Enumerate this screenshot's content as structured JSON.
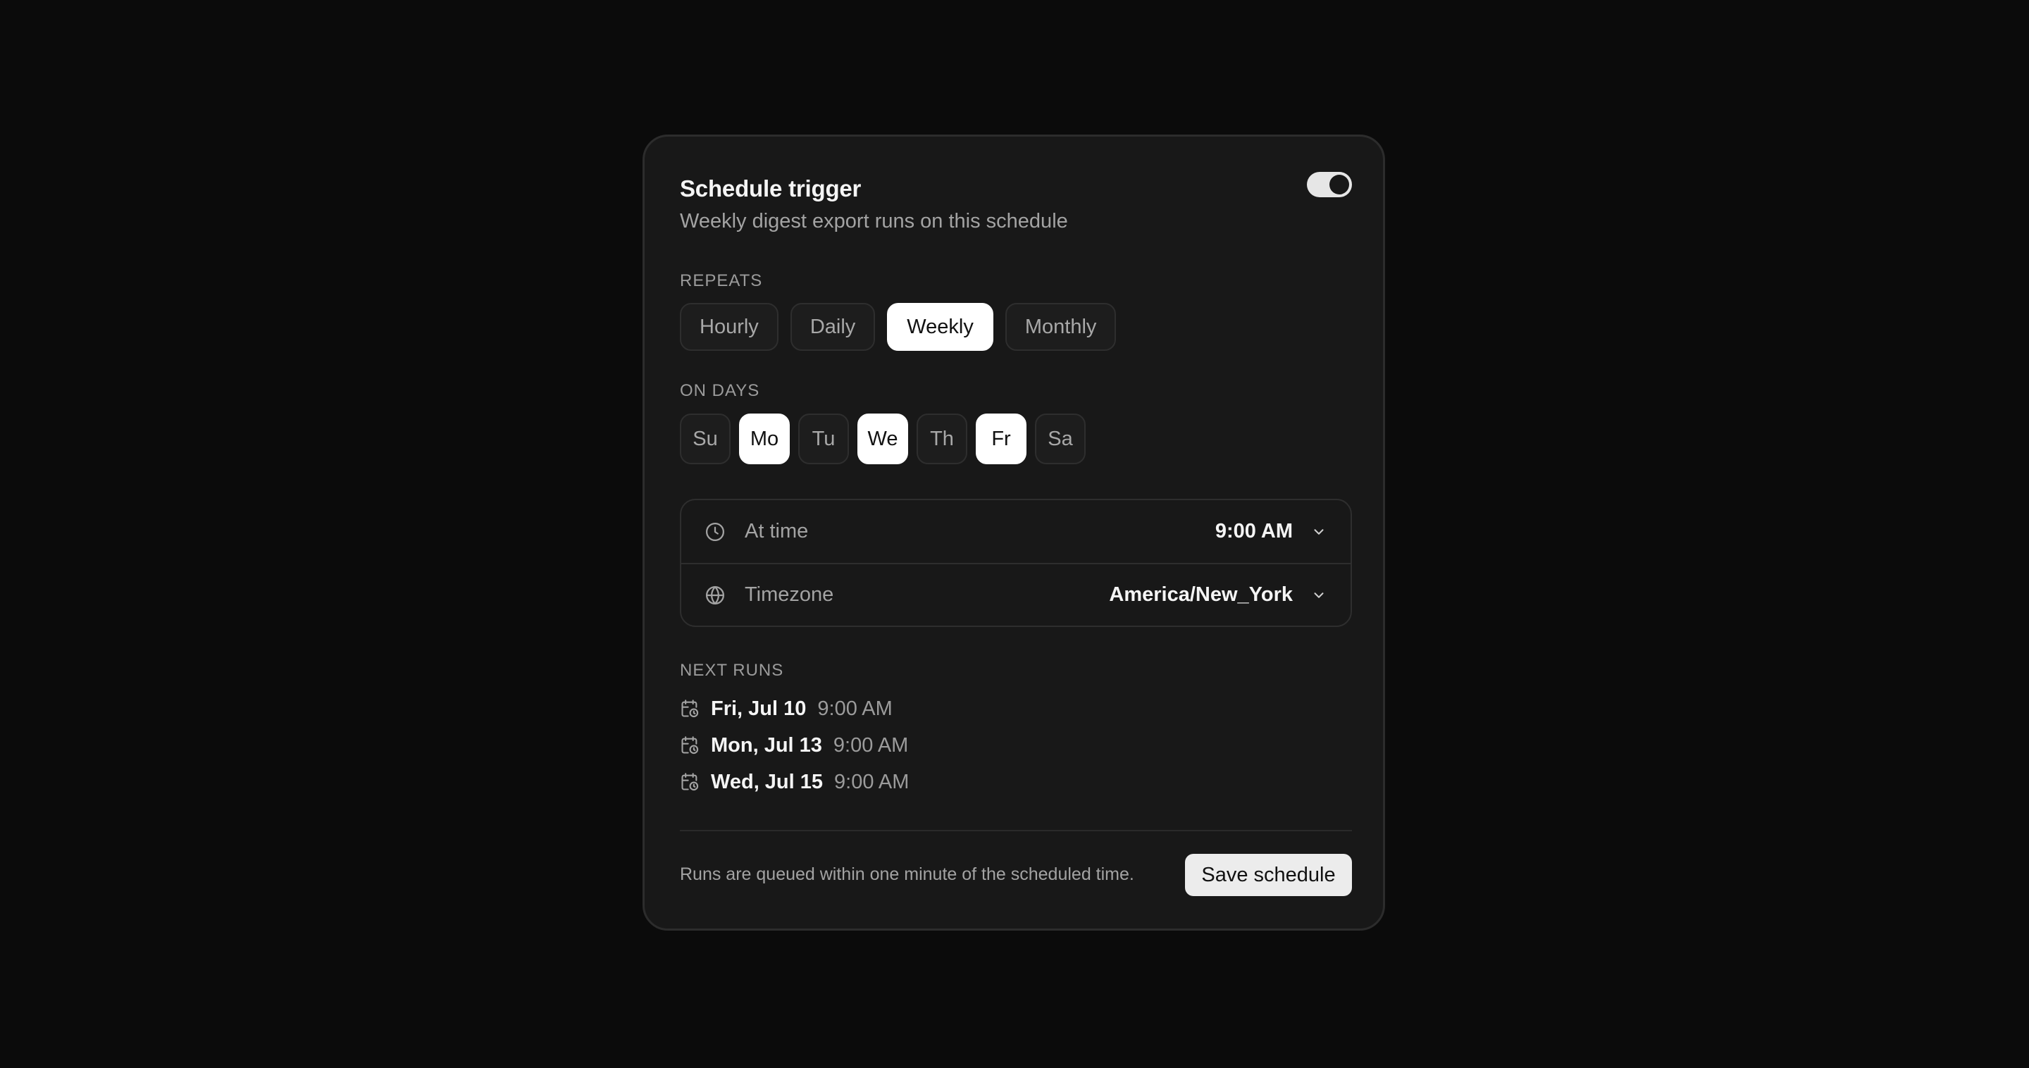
{
  "header": {
    "title": "Schedule trigger",
    "subtitle": "Weekly digest export runs on this schedule",
    "toggle_on": true
  },
  "repeats": {
    "label": "REPEATS",
    "options": [
      {
        "label": "Hourly",
        "selected": false
      },
      {
        "label": "Daily",
        "selected": false
      },
      {
        "label": "Weekly",
        "selected": true
      },
      {
        "label": "Monthly",
        "selected": false
      }
    ]
  },
  "days": {
    "label": "ON DAYS",
    "items": [
      {
        "label": "Su",
        "selected": false
      },
      {
        "label": "Mo",
        "selected": true
      },
      {
        "label": "Tu",
        "selected": false
      },
      {
        "label": "We",
        "selected": true
      },
      {
        "label": "Th",
        "selected": false
      },
      {
        "label": "Fr",
        "selected": true
      },
      {
        "label": "Sa",
        "selected": false
      }
    ]
  },
  "settings": {
    "time": {
      "label": "At time",
      "value": "9:00 AM",
      "icon": "clock-icon"
    },
    "timezone": {
      "label": "Timezone",
      "value": "America/New_York",
      "icon": "globe-icon"
    }
  },
  "next_runs": {
    "label": "NEXT RUNS",
    "items": [
      {
        "date": "Fri, Jul 10",
        "time": "9:00 AM"
      },
      {
        "date": "Mon, Jul 13",
        "time": "9:00 AM"
      },
      {
        "date": "Wed, Jul 15",
        "time": "9:00 AM"
      }
    ]
  },
  "footer": {
    "note": "Runs are queued within one minute of the scheduled time.",
    "save_label": "Save schedule"
  }
}
